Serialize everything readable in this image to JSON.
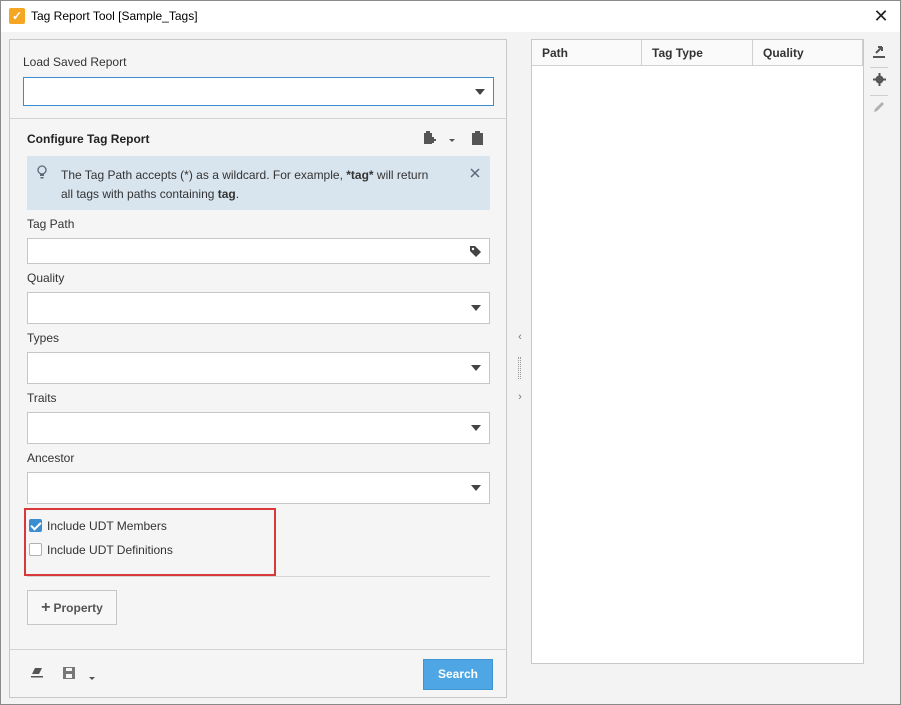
{
  "window": {
    "title": "Tag Report Tool [Sample_Tags]",
    "close_glyph": "✕"
  },
  "left": {
    "load_label": "Load Saved Report",
    "load_value": "",
    "configure_title": "Configure Tag Report",
    "info": {
      "text_part1": "The Tag Path accepts (*) as a wildcard. For example, ",
      "bold1": "*tag*",
      "text_part2": " will return all tags with paths containing ",
      "bold2": "tag",
      "text_part3": "."
    },
    "tag_path_label": "Tag Path",
    "tag_path_value": "",
    "quality_label": "Quality",
    "types_label": "Types",
    "traits_label": "Traits",
    "ancestor_label": "Ancestor",
    "include_udt_members": {
      "label": "Include UDT Members",
      "checked": true
    },
    "include_udt_definitions": {
      "label": "Include UDT Definitions",
      "checked": false
    },
    "property_button": "Property",
    "search_button": "Search"
  },
  "table": {
    "columns": [
      "Path",
      "Tag Type",
      "Quality"
    ],
    "rows": []
  },
  "colors": {
    "accent": "#3c8dcf",
    "search_button": "#4ea7e4",
    "highlight": "#d9383a",
    "info_bg": "#d8e4ee"
  },
  "icons": {
    "app": "tag-report-app-icon",
    "bulb": "lightbulb-icon",
    "tag": "tag-icon",
    "paste": "paste-icon",
    "clipboard": "clipboard-icon",
    "eraser": "eraser-icon",
    "save": "save-icon",
    "export": "export-icon",
    "settings": "gear-icon",
    "edit": "pencil-icon"
  }
}
